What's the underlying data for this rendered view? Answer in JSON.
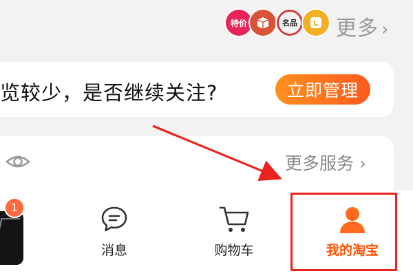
{
  "top_row": {
    "badges": [
      {
        "icon": "tejia-badge-icon",
        "label": "特价",
        "color": "#e8245a"
      },
      {
        "icon": "box-badge-icon",
        "label": "",
        "color": "#d9533a"
      },
      {
        "icon": "mingpin-badge-icon",
        "label": "名品",
        "color": "#d33a3a"
      },
      {
        "icon": "coupon-badge-icon",
        "label": "",
        "color": "#f3b024"
      }
    ],
    "more_label": "更多",
    "more_chevron": "›"
  },
  "notice": {
    "text": "览较少，是否继续关注?",
    "button_label": "立即管理",
    "button_color": "#ff6a1f"
  },
  "services": {
    "eye_icon": "eye-icon",
    "more_services_label": "更多服务",
    "chevron": "›"
  },
  "tabbar": {
    "avatar_badge_count": "1",
    "tabs": [
      {
        "icon": "message-icon",
        "label": "消息"
      },
      {
        "icon": "cart-icon",
        "label": "购物车"
      },
      {
        "icon": "user-icon",
        "label": "我的淘宝",
        "active": true,
        "active_color": "#ff5000"
      }
    ]
  },
  "annotation": {
    "highlight_color": "#e8231d"
  }
}
